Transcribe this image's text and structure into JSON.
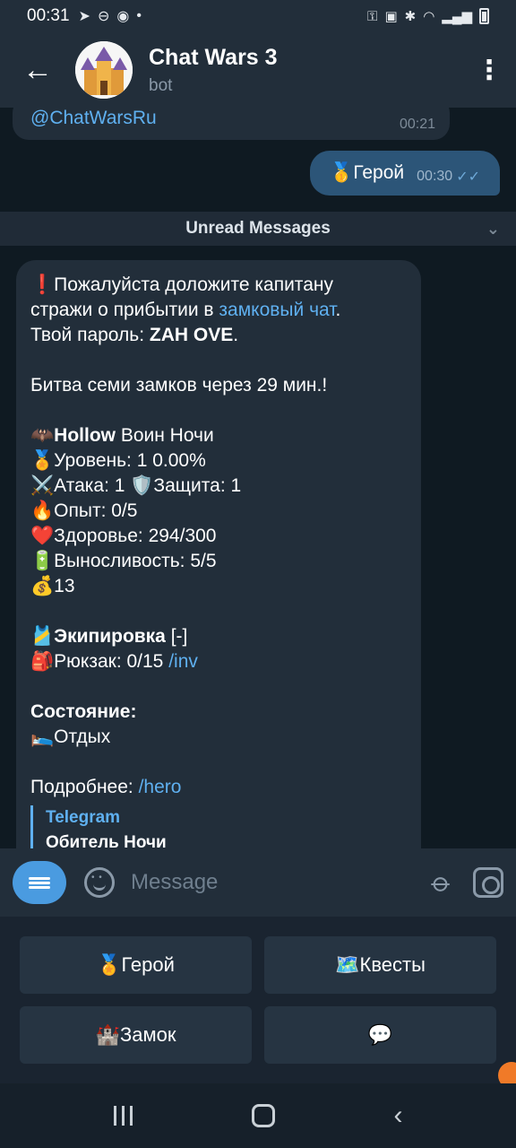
{
  "status_bar": {
    "time": "00:31",
    "left_icons": [
      "telegram-icon",
      "dnd-icon",
      "app-icon",
      "dot"
    ],
    "right_icons": [
      "key-icon",
      "lock-icon",
      "bluetooth-icon",
      "wifi-icon",
      "signal-icon",
      "battery-icon"
    ]
  },
  "header": {
    "back_glyph": "←",
    "title": "Chat Wars 3",
    "subtitle": "bot",
    "menu_glyph": "⋮"
  },
  "messages": {
    "top_incoming": {
      "link": "@ChatWarsRu",
      "time": "00:21"
    },
    "outgoing": {
      "text": "🥇Герой",
      "time": "00:30",
      "ticks": "✓✓"
    },
    "unread_label": "Unread Messages",
    "main": {
      "l1_emoji": "❗",
      "l1_text": "Пожалуйста доложите капитану",
      "l2_text": "стражи о прибытии в ",
      "l2_link": "замковый чат",
      "l2_end": ".",
      "l3_text": "Твой пароль: ",
      "l3_bold": "ZAH OVE",
      "l3_end": ".",
      "l4_text": "Битва семи замков через 29 мин.!",
      "l5_emoji": "🦇",
      "l5_bold": "Hollow",
      "l5_text": " Воин Ночи",
      "l6": "🏅Уровень: 1 0.00%",
      "l7": "⚔️Атака: 1 🛡️Защита: 1",
      "l8": "🔥Опыт: 0/5",
      "l9": "❤️Здоровье: 294/300",
      "l10": "🔋Выносливость: 5/5",
      "l11": "💰13",
      "l12_emoji": "🎽",
      "l12_bold": "Экипировка",
      "l12_text": " [-]",
      "l13_text": "🎒Рюкзак: 0/15 ",
      "l13_link": "/inv",
      "l14_bold": "Состояние:",
      "l15": "🛌Отдых",
      "l16_text": "Подробнее: ",
      "l16_link": "/hero",
      "quote_title": "Telegram",
      "quote_sub": "Обитель Ночи"
    }
  },
  "composer": {
    "placeholder": "Message"
  },
  "keyboard": {
    "rows": [
      [
        "🏅Герой",
        "🗺️Квесты"
      ],
      [
        "🏰Замок",
        "💬"
      ]
    ]
  },
  "nav": {
    "back_glyph": "‹"
  }
}
